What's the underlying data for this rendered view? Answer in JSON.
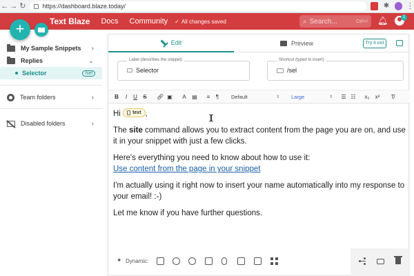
{
  "browser": {
    "url": "https://dashboard.blaze.today/",
    "icons": [
      "back-icon",
      "forward-icon",
      "reload-icon",
      "lock-icon",
      "blaze-extension-icon",
      "extensions-icon",
      "profile-icon",
      "menu-dots-icon"
    ]
  },
  "appbar": {
    "brand": "Text Blaze",
    "nav": [
      "Docs",
      "Community"
    ],
    "saved_status": "All changes saved",
    "search_placeholder": "Search...",
    "search_shortcut": "Ctrl+/",
    "notification_badge": "1",
    "color": "#d43d3f"
  },
  "sidebar": {
    "items": [
      {
        "label": "My Sample Snippets",
        "type": "folder"
      },
      {
        "label": "Replies",
        "type": "folder"
      },
      {
        "label": "Selector",
        "shortcut": "/sel",
        "type": "snippet",
        "selected": true
      },
      {
        "label": "Team folders",
        "type": "section"
      },
      {
        "label": "Disabled folders",
        "type": "section"
      }
    ]
  },
  "editor": {
    "tabs": [
      {
        "label": "Edit",
        "active": true
      },
      {
        "label": "Preview",
        "active": false
      }
    ],
    "try_it_label": "Try it out",
    "label_field": {
      "caption": "Label (describes the snippet)",
      "value": "Selector"
    },
    "shortcut_field": {
      "caption": "Shortcut (typed to insert)",
      "value": "/sel"
    },
    "toolbar": {
      "buttons": [
        "B",
        "I",
        "U",
        "S"
      ],
      "font_select": "Default",
      "size_select": "Large"
    },
    "content": {
      "greeting": "Hi",
      "chip": "text",
      "greeting_end": ",",
      "p1_pre": "The ",
      "p1_bold": "site",
      "p1_post": " command allows you to extract content from the page you are on, and use it in your snippet with just a few clicks.",
      "p2": "Here's everything you need to know about how to use it:",
      "p2_link": "Use content from the page in your snippet",
      "p3": "I'm actually using it right now to insert your name automatically into my response to your email! :-)",
      "p4": "Let me know if you have further questions."
    },
    "bottom": {
      "dynamic_label": "Dynamic:"
    },
    "accent": "#1b8f8b",
    "link_color": "#1a5ea8"
  }
}
